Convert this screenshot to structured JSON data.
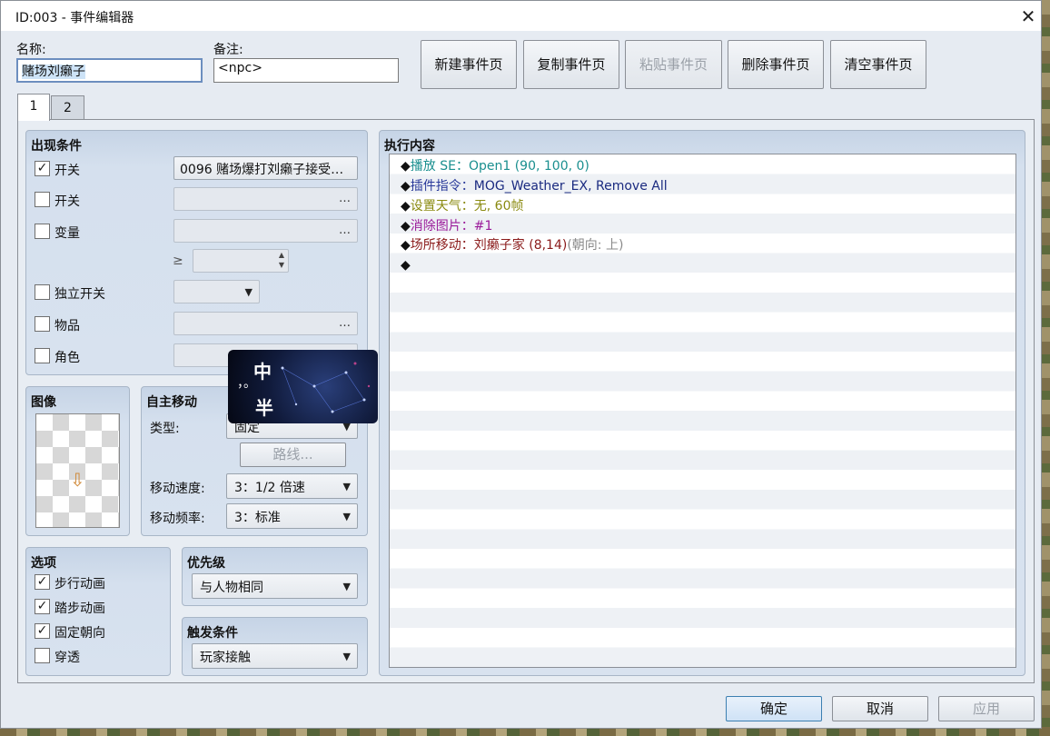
{
  "window": {
    "title": "ID:003 - 事件编辑器"
  },
  "fields": {
    "name_label": "名称:",
    "name_value": "赌场刘癞子",
    "note_label": "备注:",
    "note_value": "<npc>"
  },
  "toolbar": {
    "new": "新建事件页",
    "copy": "复制事件页",
    "paste": "粘贴事件页",
    "delete": "删除事件页",
    "clear": "清空事件页"
  },
  "tabs": [
    "1",
    "2"
  ],
  "conditions": {
    "title": "出现条件",
    "switch1_label": "开关",
    "switch1_value": "0096 赌场爆打刘癞子接受…",
    "switch2_label": "开关",
    "variable_label": "变量",
    "gte": "≥",
    "self_switch_label": "独立开关",
    "item_label": "物品",
    "actor_label": "角色",
    "dots": "…"
  },
  "image": {
    "title": "图像"
  },
  "movement": {
    "title": "自主移动",
    "type_label": "类型:",
    "type_value": "固定",
    "route_button": "路线...",
    "speed_label": "移动速度:",
    "speed_value": "3：1/2 倍速",
    "freq_label": "移动频率:",
    "freq_value": "3：标准"
  },
  "options": {
    "title": "选项",
    "items": [
      {
        "label": "步行动画",
        "checked": true
      },
      {
        "label": "踏步动画",
        "checked": true
      },
      {
        "label": "固定朝向",
        "checked": true
      },
      {
        "label": "穿透",
        "checked": false
      }
    ]
  },
  "priority": {
    "title": "优先级",
    "value": "与人物相同"
  },
  "trigger": {
    "title": "触发条件",
    "value": "玩家接触"
  },
  "contents": {
    "title": "执行内容",
    "lines": [
      {
        "bullet": "◆",
        "head": "播放 SE：",
        "body": "Open1 (90, 100, 0)",
        "extra": "",
        "color": "#1a8f8f",
        "extra_color": ""
      },
      {
        "bullet": "◆",
        "head": "插件指令：",
        "body": "MOG_Weather_EX, Remove All",
        "extra": "",
        "color": "#1a2aa0",
        "extra_color": ""
      },
      {
        "bullet": "◆",
        "head": "设置天气：",
        "body": "无, 60帧",
        "extra": "",
        "color": "#8a8a10",
        "extra_color": ""
      },
      {
        "bullet": "◆",
        "head": "消除图片：",
        "body": "#1",
        "extra": "",
        "color": "#9a1a9a",
        "extra_color": ""
      },
      {
        "bullet": "◆",
        "head": "场所移动：",
        "body": "刘癞子家 (8,14)",
        "extra": "(朝向: 上)",
        "color": "#8a1a1a",
        "extra_color": "#8a8a8a"
      },
      {
        "bullet": "◆",
        "head": "",
        "body": "",
        "extra": "",
        "color": "#111111",
        "extra_color": ""
      }
    ]
  },
  "buttons": {
    "ok": "确定",
    "cancel": "取消",
    "apply": "应用"
  },
  "overlay": {
    "char1": "中",
    "char2": "半",
    "mark": "，。"
  }
}
